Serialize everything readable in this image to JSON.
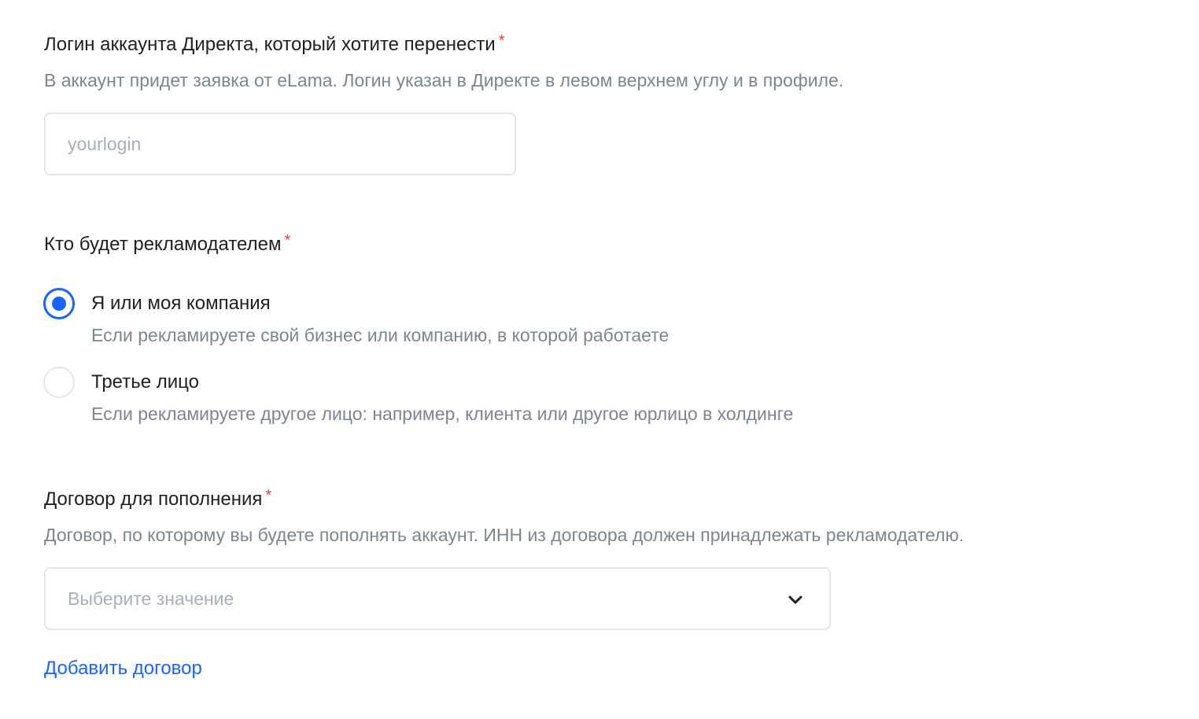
{
  "login_field": {
    "label": "Логин аккаунта Директа, который хотите перенести",
    "required_mark": "*",
    "hint": "В аккаунт придет заявка от eLama. Логин указан в Директе в левом верхнем углу и в профиле.",
    "placeholder": "yourlogin",
    "value": ""
  },
  "advertiser": {
    "label": "Кто будет рекламодателем",
    "required_mark": "*",
    "options": [
      {
        "label": "Я или моя компания",
        "description": "Если рекламируете свой бизнес или компанию, в которой работаете",
        "selected": true
      },
      {
        "label": "Третье лицо",
        "description": "Если рекламируете другое лицо: например, клиента или другое юрлицо в холдинге",
        "selected": false
      }
    ]
  },
  "contract": {
    "label": "Договор для пополнения",
    "required_mark": "*",
    "hint": "Договор, по которому вы будете пополнять аккаунт. ИНН из договора должен принадлежать рекламодателю.",
    "select_placeholder": "Выберите значение",
    "add_link": "Добавить договор"
  },
  "colors": {
    "accent": "#1764ff",
    "required": "#ef3b3b",
    "hint_text": "#7d8590",
    "border": "#e3e6ea"
  },
  "icons": {
    "select_arrow": "chevron-down-icon"
  }
}
